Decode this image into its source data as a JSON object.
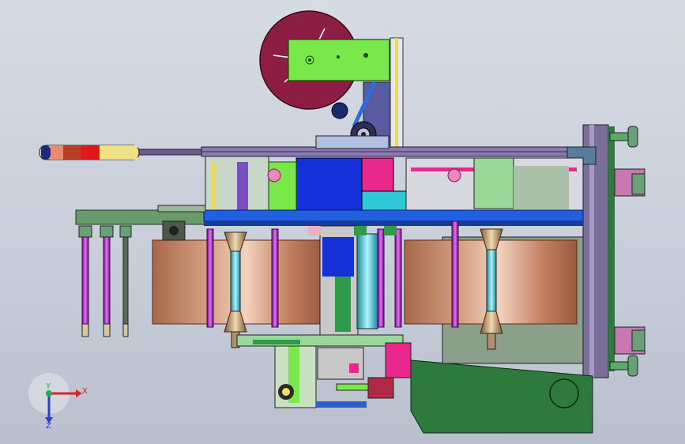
{
  "viewport": {
    "background_top": "#d6dbe4",
    "background_bottom": "#b9c0cd"
  },
  "triad": {
    "x_label": "X",
    "y_label": "Y",
    "z_label": "Z",
    "x_color": "#e0202a",
    "y_color": "#22b04a",
    "z_color": "#2a3fc8"
  },
  "colors": {
    "reel": "#8c1e44",
    "green_plate": "#7ae84a",
    "frame_blue": "#1530d8",
    "magenta": "#e8288c",
    "copper": "#c88866",
    "purple_rod": "#b030c8",
    "dark_green_base": "#2e7a3c",
    "cyan": "#2ec8d8",
    "shaft": "#6e5a8c",
    "yellow": "#f0e060"
  }
}
